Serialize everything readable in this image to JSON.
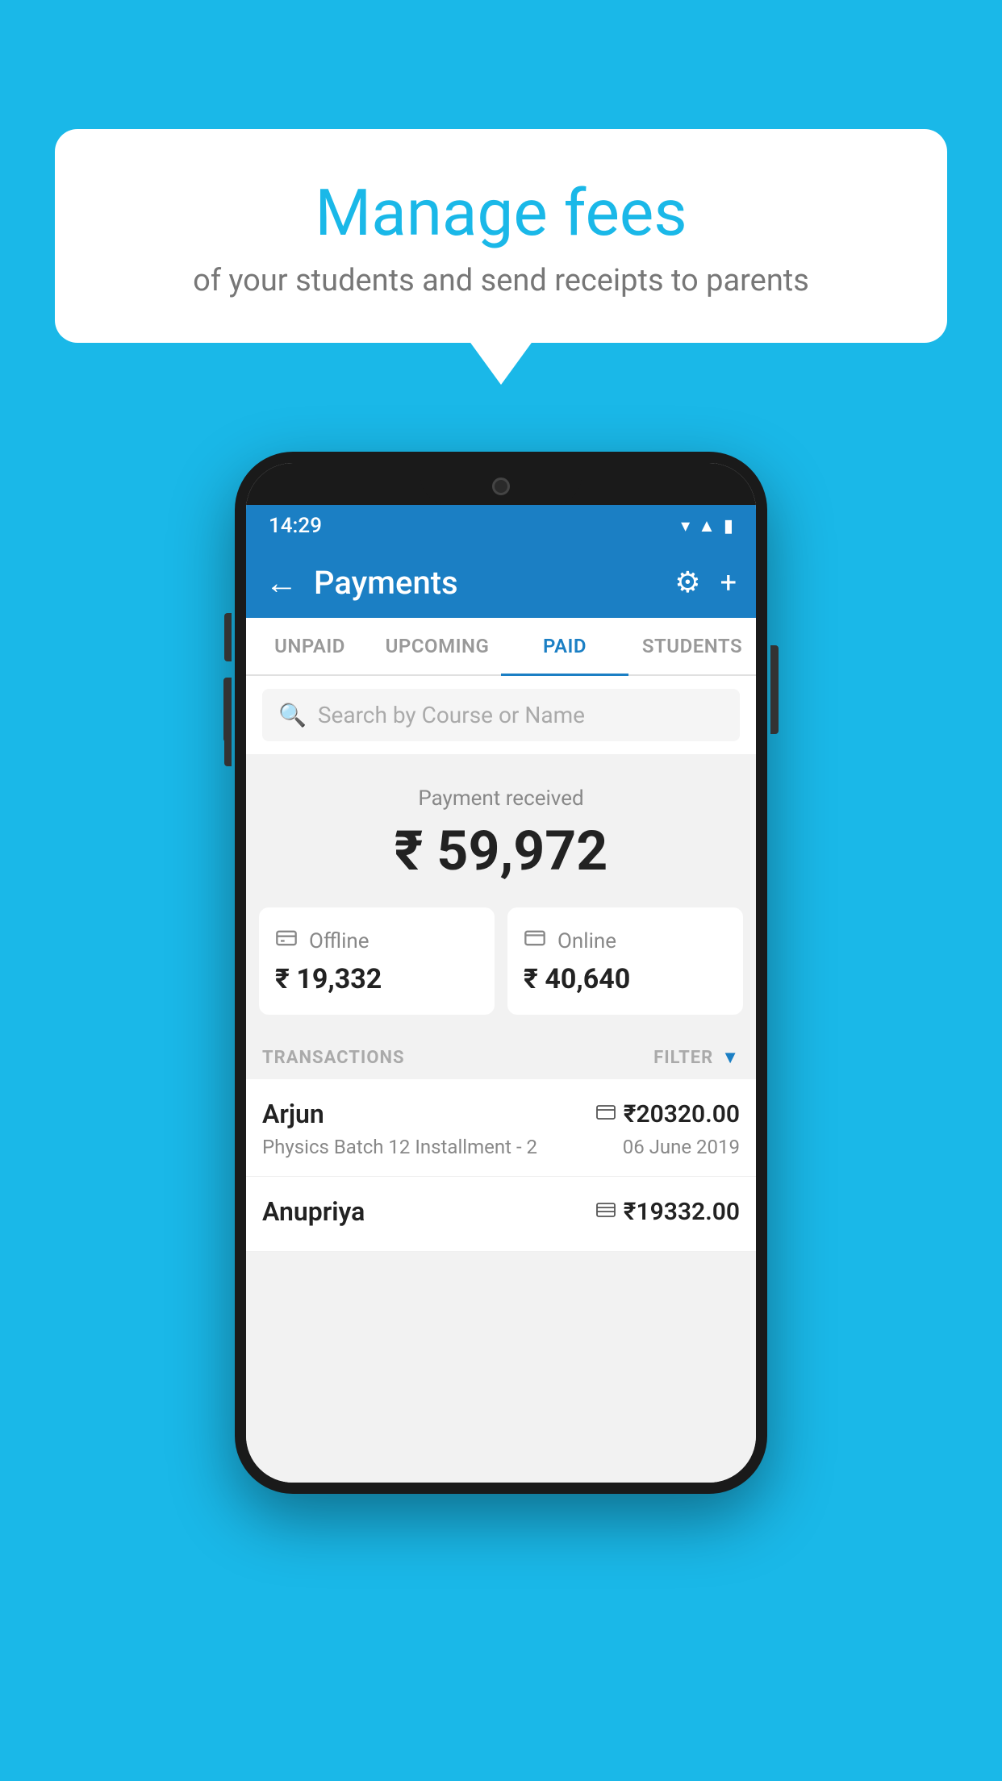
{
  "background_color": "#1ab8e8",
  "speech_bubble": {
    "title": "Manage fees",
    "subtitle": "of your students and send receipts to parents"
  },
  "phone": {
    "status_bar": {
      "time": "14:29",
      "icons": [
        "wifi",
        "signal",
        "battery"
      ]
    },
    "header": {
      "title": "Payments",
      "back_label": "←",
      "settings_icon": "⚙",
      "add_icon": "+"
    },
    "tabs": [
      {
        "label": "UNPAID",
        "active": false
      },
      {
        "label": "UPCOMING",
        "active": false
      },
      {
        "label": "PAID",
        "active": true
      },
      {
        "label": "STUDENTS",
        "active": false
      }
    ],
    "search": {
      "placeholder": "Search by Course or Name"
    },
    "payment_received": {
      "label": "Payment received",
      "amount": "₹ 59,972"
    },
    "payment_cards": [
      {
        "type": "Offline",
        "icon": "💵",
        "amount": "₹ 19,332"
      },
      {
        "type": "Online",
        "icon": "💳",
        "amount": "₹ 40,640"
      }
    ],
    "transactions_label": "TRANSACTIONS",
    "filter_label": "FILTER",
    "transactions": [
      {
        "name": "Arjun",
        "payment_method": "card",
        "amount": "₹20320.00",
        "detail": "Physics Batch 12 Installment - 2",
        "date": "06 June 2019"
      },
      {
        "name": "Anupriya",
        "payment_method": "cash",
        "amount": "₹19332.00",
        "detail": "",
        "date": ""
      }
    ]
  }
}
